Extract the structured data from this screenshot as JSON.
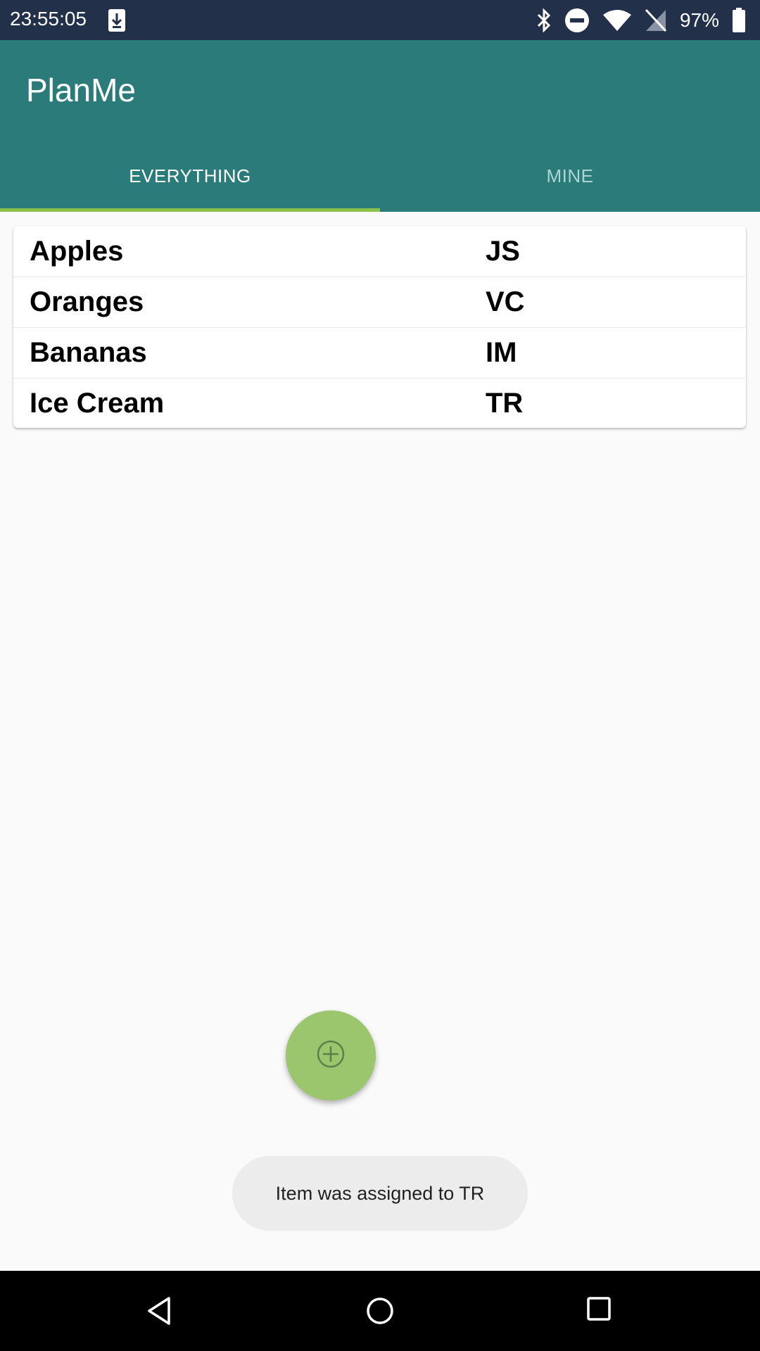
{
  "status_bar": {
    "time": "23:55:05",
    "battery_percent": "97%",
    "icons": [
      "download-icon",
      "bluetooth-icon",
      "do-not-disturb-icon",
      "wifi-icon",
      "no-sim-icon",
      "battery-icon"
    ]
  },
  "app": {
    "title": "PlanMe",
    "colors": {
      "primary": "#2a7b7a",
      "accent": "#8bc34a",
      "fab": "#9bc66e"
    }
  },
  "tabs": [
    {
      "label": "EVERYTHING",
      "selected": true
    },
    {
      "label": "MINE",
      "selected": false
    }
  ],
  "items": [
    {
      "name": "Apples",
      "assignee": "JS"
    },
    {
      "name": "Oranges",
      "assignee": "VC"
    },
    {
      "name": "Bananas",
      "assignee": "IM"
    },
    {
      "name": "Ice Cream",
      "assignee": "TR"
    }
  ],
  "fab": {
    "icon": "add-circle-icon"
  },
  "toast": {
    "message": "Item was assigned to TR"
  },
  "nav_bar": {
    "icons": [
      "back-icon",
      "home-icon",
      "recents-icon"
    ]
  }
}
